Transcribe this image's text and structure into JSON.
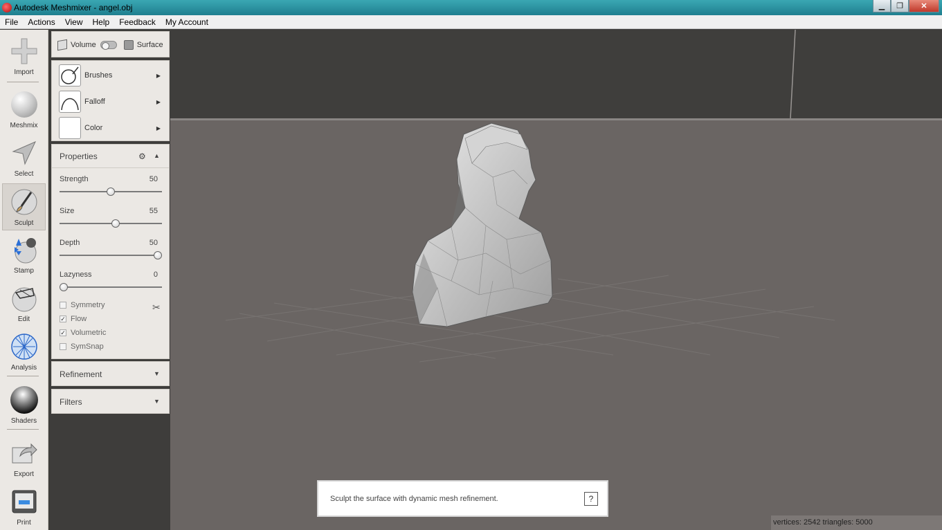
{
  "window": {
    "title": "Autodesk Meshmixer - angel.obj",
    "minimize": "▁",
    "maximize": "❐",
    "close": "✕"
  },
  "menu": [
    "File",
    "Actions",
    "View",
    "Help",
    "Feedback",
    "My Account"
  ],
  "toolbar": [
    {
      "label": "Import",
      "icon": "plus-icon"
    },
    {
      "label": "Meshmix",
      "icon": "meshmix-icon"
    },
    {
      "label": "Select",
      "icon": "arrow-icon"
    },
    {
      "label": "Sculpt",
      "icon": "brush-icon",
      "active": true
    },
    {
      "label": "Stamp",
      "icon": "stamp-icon"
    },
    {
      "label": "Edit",
      "icon": "edit-icon"
    },
    {
      "label": "Analysis",
      "icon": "analysis-icon"
    },
    {
      "label": "Shaders",
      "icon": "shader-icon"
    },
    {
      "label": "Export",
      "icon": "export-icon"
    },
    {
      "label": "Print",
      "icon": "printer-icon"
    }
  ],
  "mode": {
    "volume": "Volume",
    "surface": "Surface"
  },
  "brush_panel": {
    "brushes": "Brushes",
    "falloff": "Falloff",
    "color": "Color"
  },
  "properties": {
    "title": "Properties",
    "sliders": [
      {
        "label": "Strength",
        "value": "50",
        "fraction": 0.5
      },
      {
        "label": "Size",
        "value": "55",
        "fraction": 0.55
      },
      {
        "label": "Depth",
        "value": "50",
        "fraction": 1.0
      },
      {
        "label": "Lazyness",
        "value": "0",
        "fraction": 0.0
      }
    ],
    "checks": [
      {
        "label": "Symmetry",
        "checked": false
      },
      {
        "label": "Flow",
        "checked": true
      },
      {
        "label": "Volumetric",
        "checked": true
      },
      {
        "label": "SymSnap",
        "checked": false
      }
    ]
  },
  "refinement": "Refinement",
  "filters": "Filters",
  "hint": {
    "text": "Sculpt the surface with dynamic mesh refinement.",
    "help": "?"
  },
  "status": "vertices: 2542 triangles: 5000"
}
